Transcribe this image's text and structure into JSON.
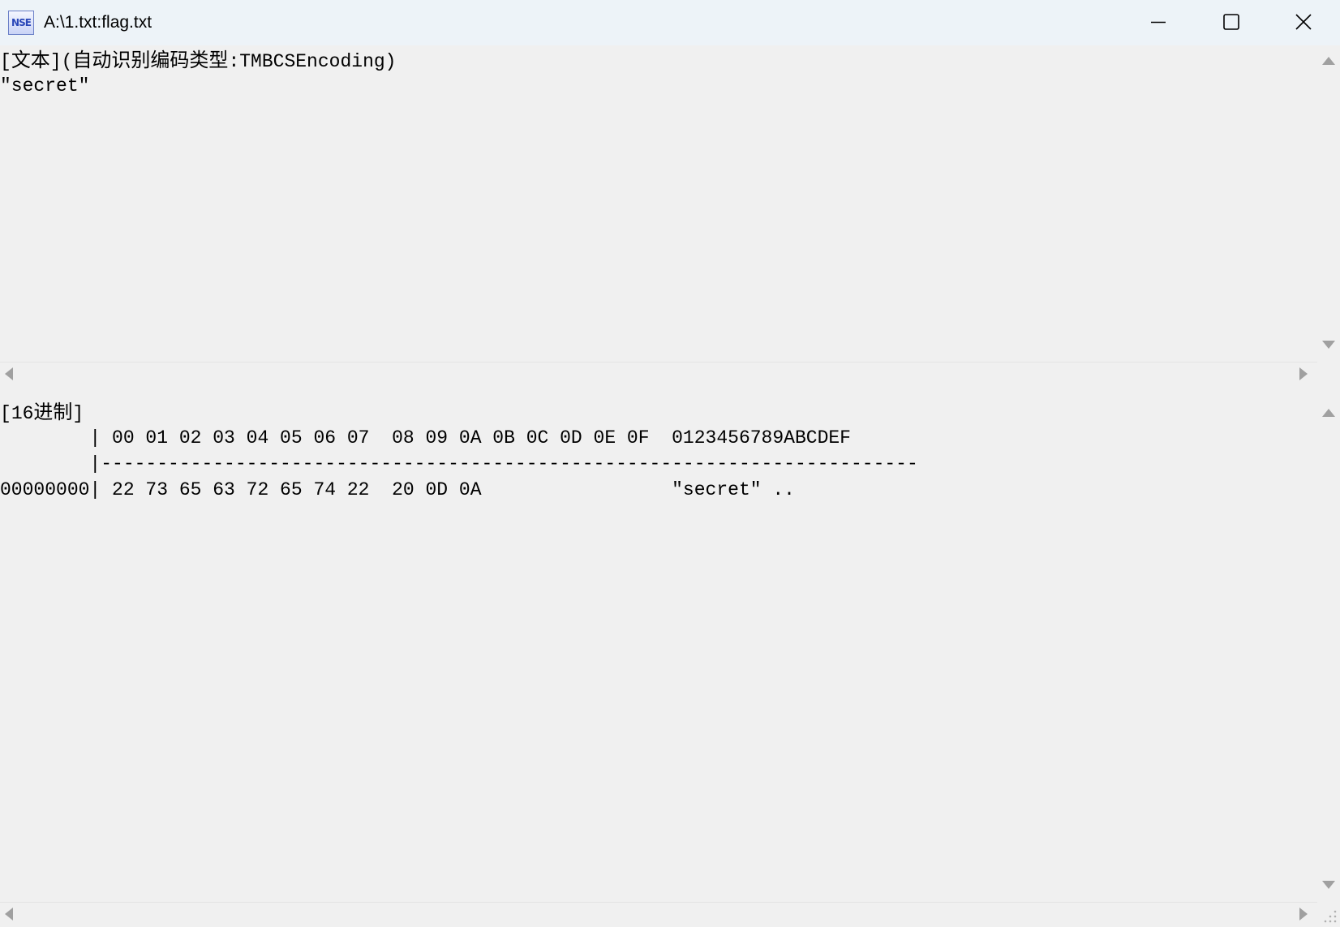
{
  "window": {
    "title": "A:\\1.txt:flag.txt",
    "icon": "nse-app-icon",
    "icon_text": "NSE"
  },
  "titlebar_buttons": {
    "minimize": "minimize-icon",
    "maximize": "maximize-icon",
    "close": "close-icon"
  },
  "text_pane": {
    "header_bracket_open": "[",
    "header_label": "文本",
    "header_bracket_close": "]",
    "encoding_prefix": "(",
    "encoding_label": "自动识别编码类型",
    "encoding_value": ":TMBCSEncoding)",
    "content": "\"secret\""
  },
  "hex_pane": {
    "header_bracket_open": "[",
    "header_label_num": "16",
    "header_label": "进制",
    "header_bracket_close": "]",
    "column_header": "        | 00 01 02 03 04 05 06 07  08 09 0A 0B 0C 0D 0E 0F  0123456789ABCDEF",
    "separator": "        |-------------------------------------------------------------------------",
    "rows": [
      {
        "offset": "00000000",
        "line": "00000000| 22 73 65 63 72 65 74 22  20 0D 0A                 \"secret\" .."
      }
    ]
  },
  "colors": {
    "background": "#f0f0f0",
    "titlebar": "#edf3f8",
    "scroll_arrow": "#a0a0a0"
  }
}
